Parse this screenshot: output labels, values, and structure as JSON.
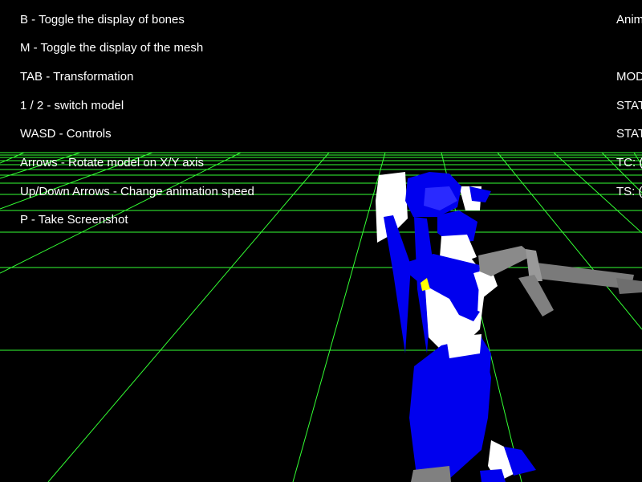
{
  "hud": {
    "controls_help": [
      "B - Toggle the display of bones",
      "M - Toggle the display of the mesh",
      "TAB - Transformation",
      "1 / 2 - switch model",
      "WASD - Controls",
      "Arrows - Rotate model on X/Y axis",
      "Up/Down Arrows - Change animation speed",
      "P - Take Screenshot"
    ],
    "status_lines": [
      "Anim",
      "MOD",
      "STAT",
      "STAT",
      "TC: (",
      "TS: ("
    ]
  },
  "scene": {
    "background_color": "#000000",
    "grid_color": "#33ff33",
    "model_primary_color": "#0000ee",
    "model_secondary_color": "#ffffff",
    "weapon_color": "#808080",
    "accent_color": "#ffff00",
    "text_color": "#ffffff"
  }
}
